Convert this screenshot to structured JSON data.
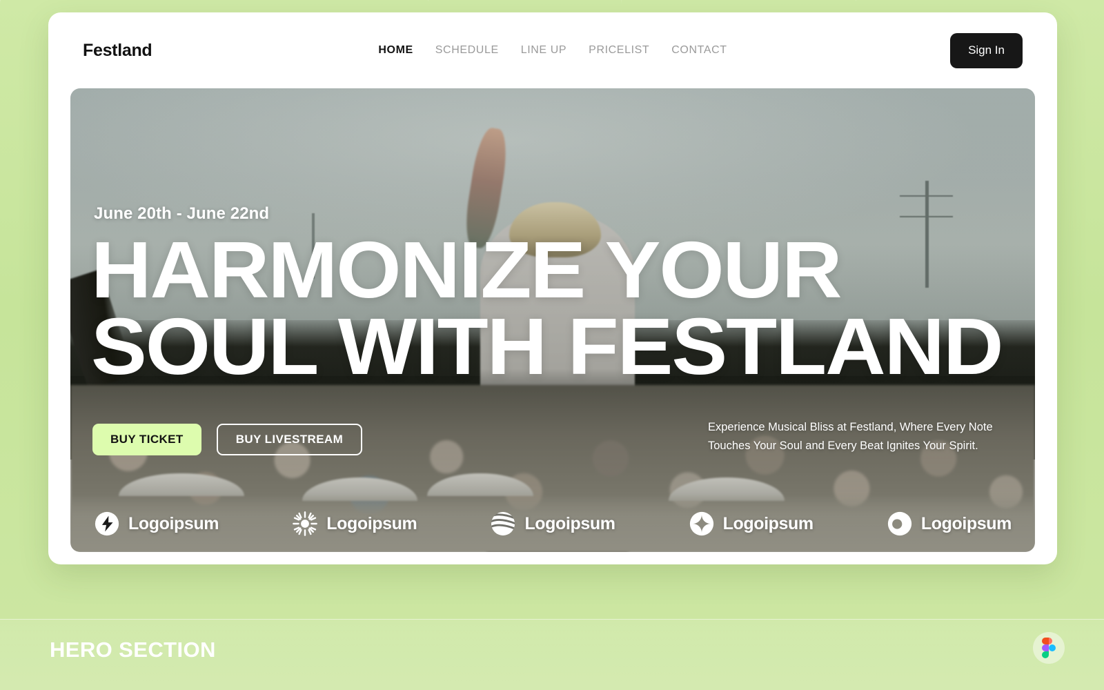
{
  "page": {
    "background_color": "#c6e49a",
    "caption": "HERO SECTION",
    "badge_icon": "figma-icon"
  },
  "navbar": {
    "brand": "Festland",
    "links": [
      {
        "label": "HOME",
        "active": true
      },
      {
        "label": "SCHEDULE",
        "active": false
      },
      {
        "label": "LINE UP",
        "active": false
      },
      {
        "label": "PRICELIST",
        "active": false
      },
      {
        "label": "CONTACT",
        "active": false
      }
    ],
    "signin_label": "Sign In"
  },
  "hero": {
    "date": "June 20th - June 22nd",
    "title_line1": "HARMONIZE YOUR",
    "title_line2": "SOUL WITH FESTLAND",
    "primary_cta": "BUY TICKET",
    "secondary_cta": "BUY LIVESTREAM",
    "description": "Experience Musical Bliss at Festland, Where Every Note Touches Your Soul and Every Beat Ignites Your Spirit.",
    "primary_cta_color": "#ddfcae",
    "image_alt": "festival performer on stage in front of crowd"
  },
  "partners": [
    {
      "name": "Logoipsum",
      "icon": "bolt-circle-icon"
    },
    {
      "name": "Logoipsum",
      "icon": "sunburst-icon"
    },
    {
      "name": "Logoipsum",
      "icon": "wave-circle-icon"
    },
    {
      "name": "Logoipsum",
      "icon": "star-circle-icon"
    },
    {
      "name": "Logoipsum",
      "icon": "moon-circle-icon"
    }
  ]
}
